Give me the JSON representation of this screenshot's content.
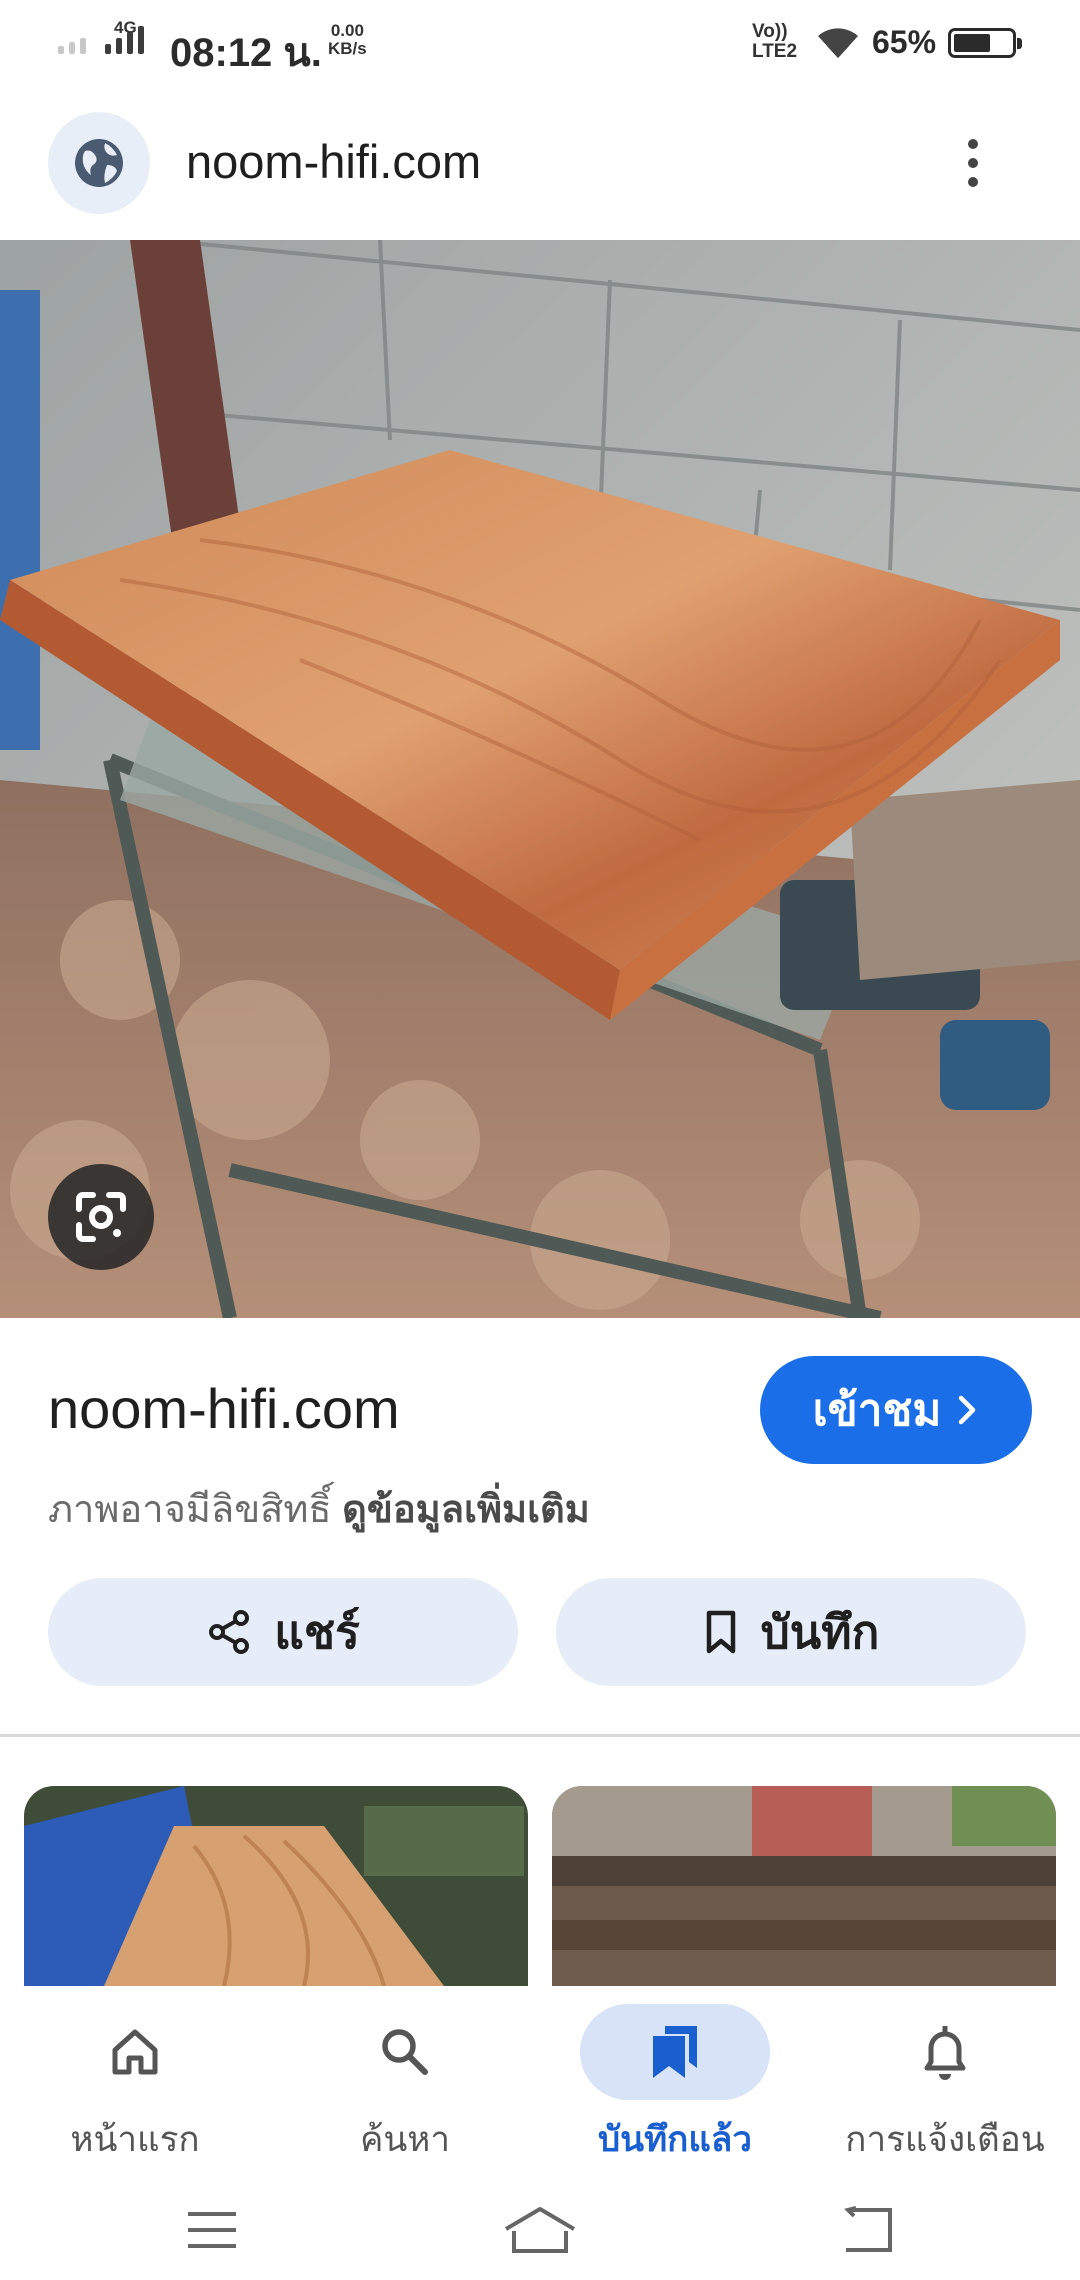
{
  "status_bar": {
    "network": "4G",
    "time": "08:12 น.",
    "speed_value": "0.00",
    "speed_unit": "KB/s",
    "volte_top": "Vo))",
    "volte_bottom": "LTE2",
    "battery_percent": "65%",
    "battery_level": 0.65
  },
  "top_bar": {
    "site_icon": "globe-icon",
    "title": "noom-hifi.com",
    "menu_icon": "more-vert-icon"
  },
  "image": {
    "subject": "wooden-slab-on-workbench",
    "lens_icon": "google-lens-icon"
  },
  "info": {
    "source": "noom-hifi.com",
    "visit_label": "เข้าชม",
    "copyright_text": "ภาพอาจมีลิขสิทธิ์",
    "more_info_link": "ดูข้อมูลเพิ่มเติม",
    "share_label": "แชร์",
    "save_label": "บันทึก"
  },
  "related_thumbnails": [
    {
      "icon": "wood-slab-thumbnail"
    },
    {
      "icon": "timber-stack-thumbnail"
    }
  ],
  "bottom_nav": [
    {
      "label": "หน้าแรก",
      "icon": "home-icon",
      "active": false
    },
    {
      "label": "ค้นหา",
      "icon": "search-icon",
      "active": false
    },
    {
      "label": "บันทึกแล้ว",
      "icon": "saved-icon",
      "active": true
    },
    {
      "label": "การแจ้งเตือน",
      "icon": "bell-icon",
      "active": false
    }
  ],
  "colors": {
    "accent": "#1a6ee8",
    "pill_bg": "#e6edf9",
    "active_nav_bg": "#d8e3f8"
  }
}
